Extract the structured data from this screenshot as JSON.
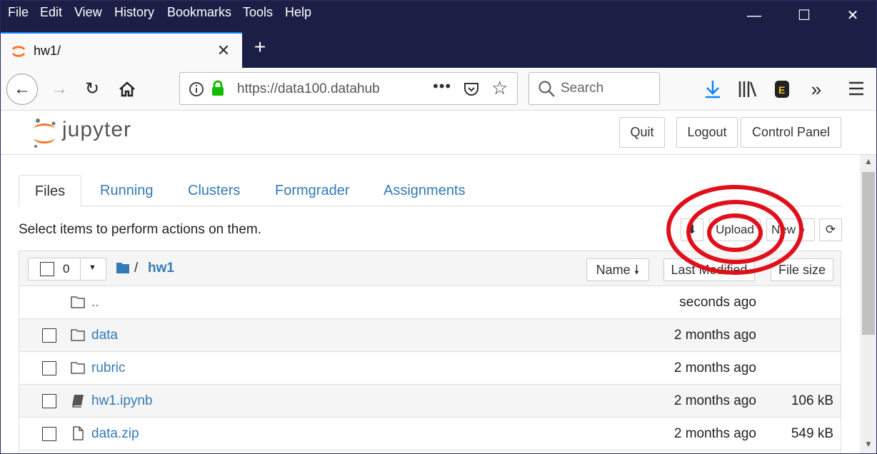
{
  "menu": [
    "File",
    "Edit",
    "View",
    "History",
    "Bookmarks",
    "Tools",
    "Help"
  ],
  "tab": {
    "title": "hw1/"
  },
  "url": "https://data100.datahub",
  "search_placeholder": "Search",
  "jupyter": {
    "logo_text": "jupyter",
    "buttons": {
      "quit": "Quit",
      "logout": "Logout",
      "control_panel": "Control Panel"
    }
  },
  "tabs": [
    "Files",
    "Running",
    "Clusters",
    "Formgrader",
    "Assignments"
  ],
  "select_text": "Select items to perform actions on them.",
  "toolbar": {
    "upload": "Upload",
    "new": "New"
  },
  "list_header": {
    "count": "0",
    "path_sep": "/",
    "folder": "hw1",
    "name_col": "Name",
    "modified_col": "Last Modified",
    "size_col": "File size"
  },
  "rows": [
    {
      "name": "..",
      "date": "seconds ago",
      "size": "",
      "icon": "folder-icon",
      "checkbox": false
    },
    {
      "name": "data",
      "date": "2 months ago",
      "size": "",
      "icon": "folder-icon",
      "checkbox": true
    },
    {
      "name": "rubric",
      "date": "2 months ago",
      "size": "",
      "icon": "folder-icon",
      "checkbox": true
    },
    {
      "name": "hw1.ipynb",
      "date": "2 months ago",
      "size": "106 kB",
      "icon": "notebook-icon",
      "checkbox": true
    },
    {
      "name": "data.zip",
      "date": "2 months ago",
      "size": "549 kB",
      "icon": "file-icon",
      "checkbox": true
    }
  ],
  "colors": {
    "menubar": "#1b1f45",
    "link": "#337ab7",
    "annotation": "#e0101a",
    "jupyter_orange": "#f37726",
    "lock_green": "#12bc00",
    "download_blue": "#0a84ff"
  }
}
